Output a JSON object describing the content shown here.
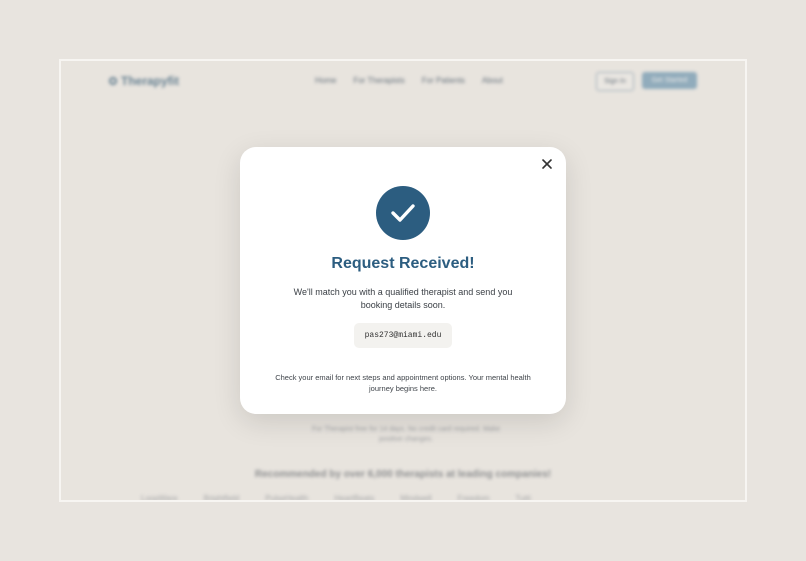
{
  "background": {
    "logo_text": "Therapyfit",
    "nav": [
      "Home",
      "For Therapists",
      "For Patients",
      "About"
    ],
    "sign_in": "Sign In",
    "get_started": "Get Started",
    "fine_print": "For Therapist free for 14 days. No credit card required. Make positive changes.",
    "recommended": "Recommended by over 6,000 therapists at leading companies!",
    "company_logos": [
      "LoopWare",
      "Brightfield",
      "PulseHealth",
      "HeartBeats",
      "Mindwell",
      "Freedom",
      "Tutti"
    ]
  },
  "modal": {
    "title": "Request Received!",
    "message": "We'll match you with a qualified therapist and send you booking details soon.",
    "email": "pas273@miami.edu",
    "note": "Check your email for next steps and appointment options. Your mental health journey begins here.",
    "close_icon": "close-icon",
    "success_icon": "check-icon",
    "accent": "#2c5d80"
  }
}
